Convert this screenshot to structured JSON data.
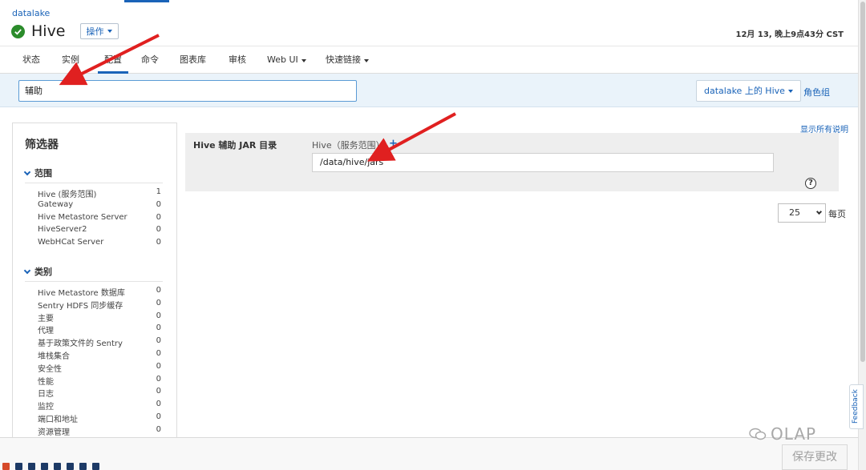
{
  "header": {
    "cluster_link": "datalake",
    "service_name": "Hive",
    "actions_label": "操作",
    "timestamp": "12月 13, 晚上9点43分 CST"
  },
  "tabs": [
    {
      "label": "状态"
    },
    {
      "label": "实例"
    },
    {
      "label": "配置"
    },
    {
      "label": "命令"
    },
    {
      "label": "图表库"
    },
    {
      "label": "审核"
    },
    {
      "label": "Web UI"
    },
    {
      "label": "快速链接"
    }
  ],
  "active_tab": "配置",
  "search": {
    "value": "辅助",
    "scope_label": "datalake 上的 Hive",
    "role_groups_link": "角色组"
  },
  "filters": {
    "title": "筛选器",
    "scope": {
      "heading": "范围",
      "items": [
        {
          "label": "Hive (服务范围)",
          "count": "1"
        },
        {
          "label": "Gateway",
          "count": "0"
        },
        {
          "label": "Hive Metastore Server",
          "count": "0"
        },
        {
          "label": "HiveServer2",
          "count": "0"
        },
        {
          "label": "WebHCat Server",
          "count": "0"
        }
      ]
    },
    "category": {
      "heading": "类别",
      "items": [
        {
          "label": "Hive Metastore 数据库",
          "count": "0"
        },
        {
          "label": "Sentry HDFS 同步缓存",
          "count": "0"
        },
        {
          "label": "主要",
          "count": "0"
        },
        {
          "label": "代理",
          "count": "0"
        },
        {
          "label": "基于政策文件的 Sentry",
          "count": "0"
        },
        {
          "label": "堆栈集合",
          "count": "0"
        },
        {
          "label": "安全性",
          "count": "0"
        },
        {
          "label": "性能",
          "count": "0"
        },
        {
          "label": "日志",
          "count": "0"
        },
        {
          "label": "监控",
          "count": "0"
        },
        {
          "label": "端口和地址",
          "count": "0"
        },
        {
          "label": "资源管理",
          "count": "0"
        }
      ]
    }
  },
  "property": {
    "name": "Hive 辅助 JAR 目录",
    "scope": "Hive（服务范围）",
    "value": "/data/hive/jars"
  },
  "show_descriptions_link": "显示所有说明",
  "pagination": {
    "per_page_value": "25",
    "per_page_label": "每页"
  },
  "save_button_label": "保存更改",
  "feedback_label": "Feedback",
  "watermark_text": "OLAP",
  "colors": {
    "accent": "#1a63b8",
    "status_ok": "#2b8c2b",
    "annotation_arrow": "#e02020"
  },
  "icons": {
    "status": "check-circle-icon",
    "help": "question-circle-icon",
    "add": "plus-icon"
  }
}
